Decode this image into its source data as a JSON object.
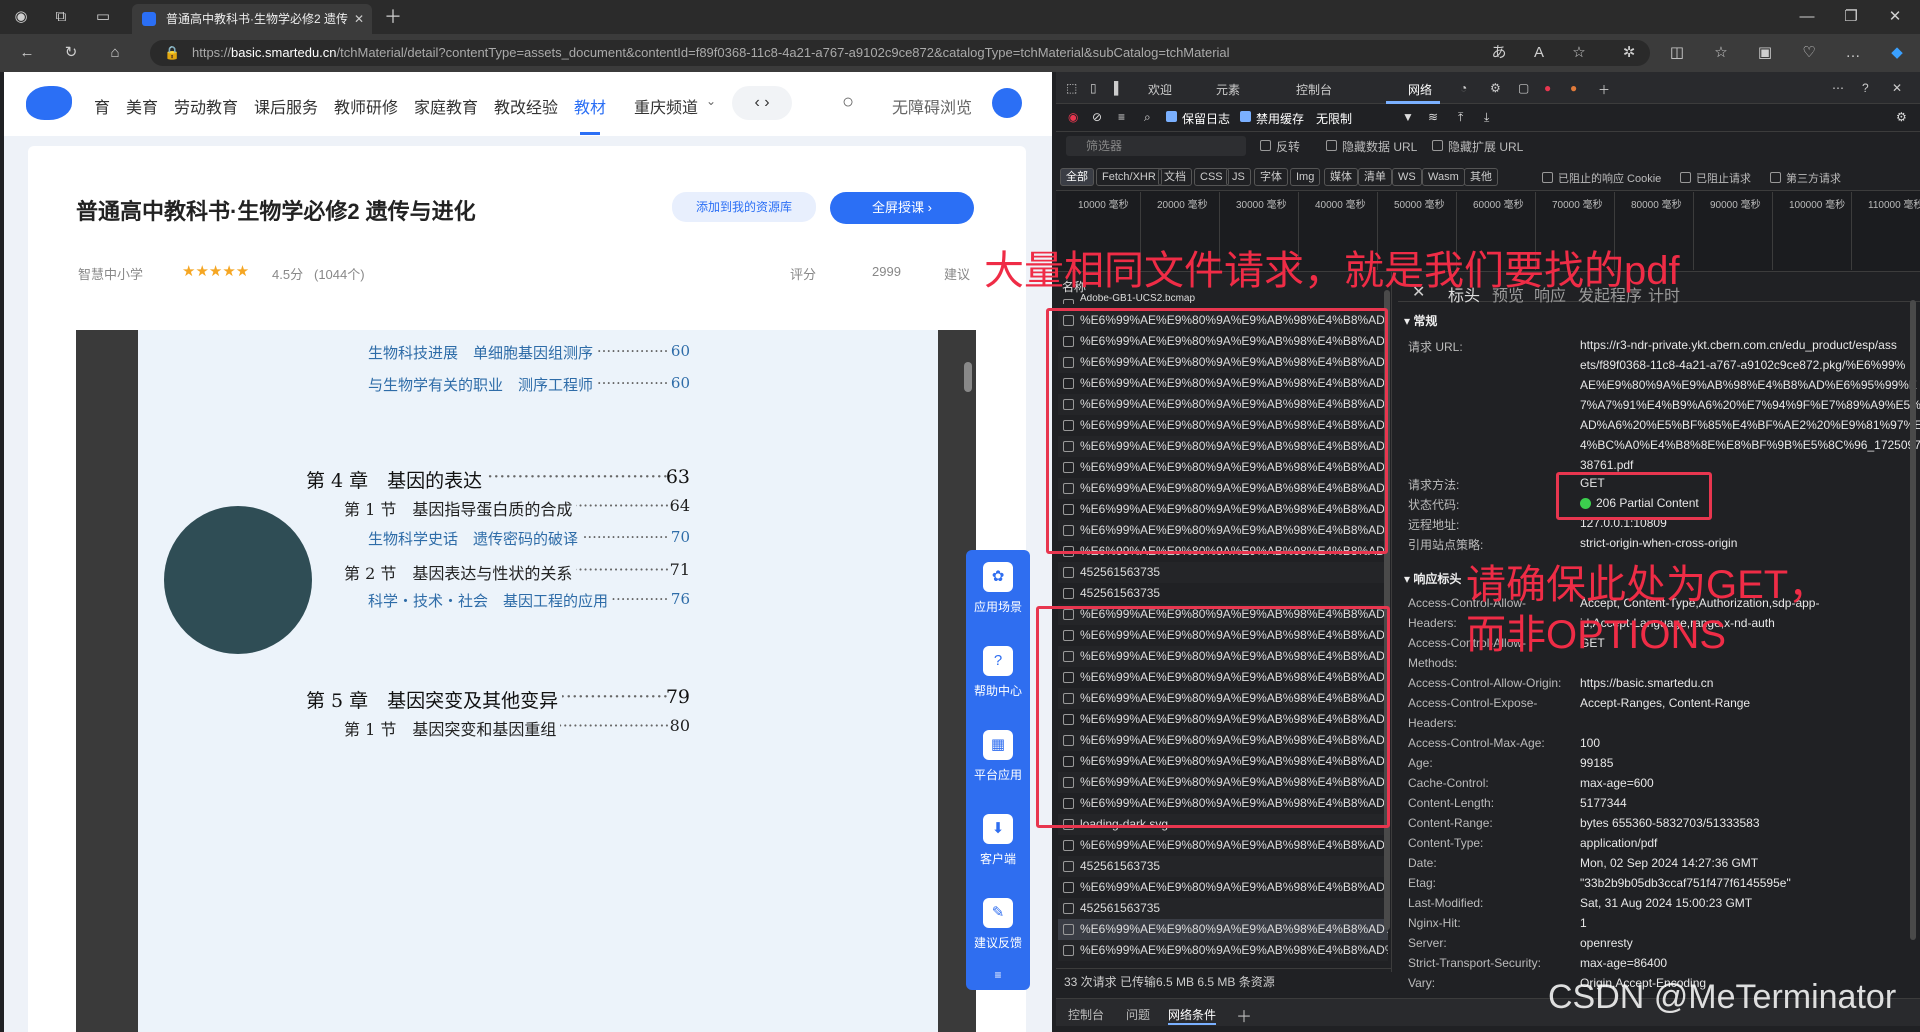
{
  "browser": {
    "tab_title": "普通高中教科书·生物学必修2 遗传",
    "url_prefix": "https://",
    "url_host": "basic.smartedu.cn",
    "url_path": "/tchMaterial/detail?contentType=assets_document&contentId=f89f0368-11c8-4a21-a767-a9102c9ce872&catalogType=tchMaterial&subCatalog=tchMaterial"
  },
  "site": {
    "nav": [
      "育",
      "美育",
      "劳动教育",
      "课后服务",
      "教师研修",
      "家庭教育",
      "教改经验",
      "教材",
      "重庆频道"
    ],
    "active_nav": "教材",
    "accessibility": "无障碍浏览",
    "book_title": "普通高中教科书·生物学必修2 遗传与进化",
    "add_to_library": "添加到我的资源库",
    "fullscreen": "全屏授课",
    "publisher": "智慧中小学",
    "rating": "4.5分",
    "rating_count": "(1044个)",
    "comment": "评分",
    "likes": "2999",
    "suggest": "建议",
    "float_menu": [
      "应用场景",
      "帮助中心",
      "平台应用",
      "客户端",
      "建议反馈"
    ]
  },
  "toc": [
    {
      "level": "sub",
      "text": "生物科技进展　单细胞基因组测序",
      "page": "60"
    },
    {
      "level": "sub",
      "text": "与生物学有关的职业　测序工程师",
      "page": "60"
    },
    {
      "level": "chap",
      "text": "第 4 章　基因的表达",
      "page": "63"
    },
    {
      "level": "sec",
      "text": "第 1 节　基因指导蛋白质的合成",
      "page": "64"
    },
    {
      "level": "sub",
      "text": "生物科学史话　遗传密码的破译",
      "page": "70"
    },
    {
      "level": "sec",
      "text": "第 2 节　基因表达与性状的关系",
      "page": "71"
    },
    {
      "level": "sub",
      "text": "科学・技术・社会　基因工程的应用",
      "page": "76"
    },
    {
      "level": "chap",
      "text": "第 5 章　基因突变及其他变异",
      "page": "79"
    },
    {
      "level": "sec",
      "text": "第 1 节　基因突变和基因重组",
      "page": "80"
    }
  ],
  "devtools": {
    "tabs": [
      "欢迎",
      "元素",
      "控制台",
      "网络"
    ],
    "active_tab": "网络",
    "toolbar": {
      "preserve_log": "保留日志",
      "disable_cache": "禁用缓存",
      "throttle": "无限制"
    },
    "filter_placeholder": "筛选器",
    "filter_options": [
      "反转",
      "隐藏数据 URL",
      "隐藏扩展 URL"
    ],
    "type_chips": [
      "全部",
      "Fetch/XHR",
      "文档",
      "CSS",
      "JS",
      "字体",
      "Img",
      "媒体",
      "清单",
      "WS",
      "Wasm",
      "其他"
    ],
    "extra_filters": [
      "已阻止的响应 Cookie",
      "已阻止请求",
      "第三方请求"
    ],
    "timeline_ticks": [
      "10000 毫秒",
      "20000 毫秒",
      "30000 毫秒",
      "40000 毫秒",
      "50000 毫秒",
      "60000 毫秒",
      "70000 毫秒",
      "80000 毫秒",
      "90000 毫秒",
      "100000 毫秒",
      "110000 毫秒"
    ],
    "name_col": "名称",
    "first_row": "Adobe-GB1-UCS2.bcmap",
    "req_pdf": "%E6%99%AE%E9%80%9A%E9%AB%98%E4%B8%AD%E...",
    "req_num": "452561563735",
    "req_loading": "loading-dark.svg",
    "detail_tabs": [
      "标头",
      "预览",
      "响应",
      "发起程序",
      "计时"
    ],
    "general_title": "常规",
    "general": {
      "request_url_label": "请求 URL:",
      "request_url": [
        "https://r3-ndr-private.ykt.cbern.com.cn/edu_product/esp/ass",
        "ets/f89f0368-11c8-4a21-a767-a9102c9ce872.pkg/%E6%99%",
        "AE%E9%80%9A%E9%AB%98%E4%B8%AD%E6%95%99%E",
        "7%A7%91%E4%B9%A6%20%E7%94%9F%E7%89%A9%E5%",
        "AD%A6%20%E5%BF%85%E4%BF%AE2%20%E9%81%97%E",
        "4%BC%A0%E4%B8%8E%E8%BF%9B%E5%8C%96_17250976",
        "38761.pdf"
      ],
      "method_label": "请求方法:",
      "method": "GET",
      "status_label": "状态代码:",
      "status": "206 Partial Content",
      "remote_label": "远程地址:",
      "remote": "127.0.0.1:10809",
      "referrer_label": "引用站点策略:",
      "referrer": "strict-origin-when-cross-origin"
    },
    "response_title": "响应标头",
    "response_headers": [
      [
        "Access-Control-Allow-",
        "Accept, Content-Type,Authorization,sdp-app-"
      ],
      [
        "Headers:",
        "id,Accept-Language,range,x-nd-auth"
      ],
      [
        "Access-Control-Allow-",
        "GET"
      ],
      [
        "Methods:",
        ""
      ],
      [
        "Access-Control-Allow-Origin:",
        "https://basic.smartedu.cn"
      ],
      [
        "Access-Control-Expose-",
        "Accept-Ranges, Content-Range"
      ],
      [
        "Headers:",
        ""
      ],
      [
        "Access-Control-Max-Age:",
        "100"
      ],
      [
        "Age:",
        "99185"
      ],
      [
        "Cache-Control:",
        "max-age=600"
      ],
      [
        "Content-Length:",
        "5177344"
      ],
      [
        "Content-Range:",
        "bytes 655360-5832703/51333583"
      ],
      [
        "Content-Type:",
        "application/pdf"
      ],
      [
        "Date:",
        "Mon, 02 Sep 2024 14:27:36 GMT"
      ],
      [
        "Etag:",
        "\"33b2b9b05db3ccaf751f477f6145595e\""
      ],
      [
        "Last-Modified:",
        "Sat, 31 Aug 2024 15:00:23 GMT"
      ],
      [
        "Nginx-Hit:",
        "1"
      ],
      [
        "Server:",
        "openresty"
      ],
      [
        "Strict-Transport-Security:",
        "max-age=86400"
      ],
      [
        "Vary:",
        "Origin,Accept-Encoding"
      ]
    ],
    "summary": "33 次请求  已传输6.5 MB  6.5 MB 条资源",
    "drawer_tabs": [
      "控制台",
      "问题",
      "网络条件"
    ]
  },
  "annotations": {
    "top": "大量相同文件请求，就是我们要找的pdf",
    "bottom_line1": "请确保此处为GET，",
    "bottom_line2": "而非OPTIONS"
  },
  "watermark": "CSDN @MeTerminator",
  "colors": {
    "accent": "#2b6ff5",
    "annotation": "#ef2c46",
    "status_ok": "#3ccf4e"
  }
}
